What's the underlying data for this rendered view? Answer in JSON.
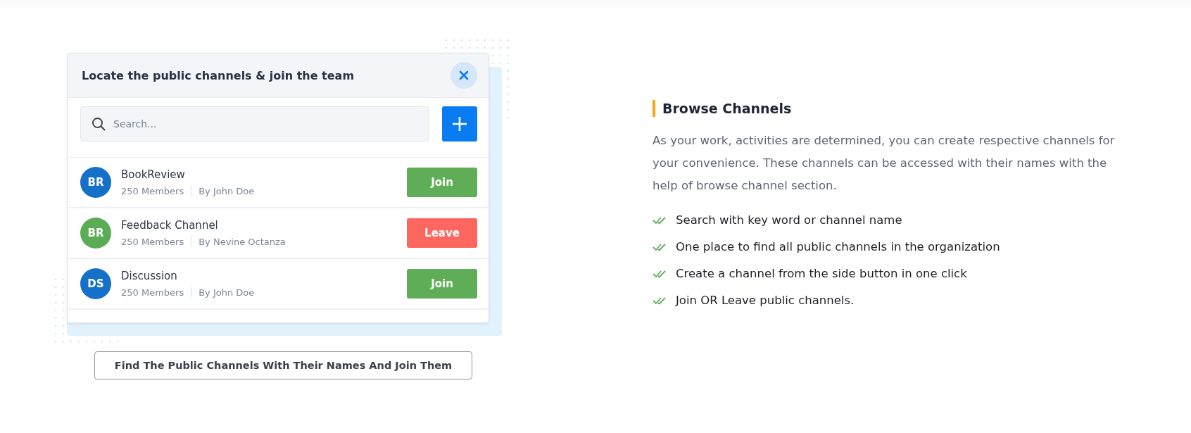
{
  "dialog": {
    "title": "Locate the public channels & join the team",
    "search": {
      "placeholder": "Search..."
    },
    "channels": [
      {
        "initials": "BR",
        "color": "#1570c9",
        "name": "BookReview",
        "members": "250 Members",
        "owner": "By John Doe",
        "action": {
          "kind": "join",
          "label": "Join"
        }
      },
      {
        "initials": "BR",
        "color": "#5aad55",
        "name": "Feedback Channel",
        "members": "250 Members",
        "owner": "By Nevine Octanza",
        "action": {
          "kind": "leave",
          "label": "Leave"
        }
      },
      {
        "initials": "DS",
        "color": "#1570c9",
        "name": "Discussion",
        "members": "250 Members",
        "owner": "By John Doe",
        "action": {
          "kind": "join",
          "label": "Join"
        }
      }
    ]
  },
  "caption": "Find The Public Channels With Their Names And Join Them",
  "feature": {
    "heading": "Browse Channels",
    "description": "As your work, activities are determined, you can create respective channels for your convenience. These channels can be accessed with their names with the help of browse channel section.",
    "points": [
      "Search with key word or channel name",
      "One place to find all public channels in the organization",
      "Create a channel from the side button in one click",
      "Join OR Leave public channels."
    ]
  }
}
